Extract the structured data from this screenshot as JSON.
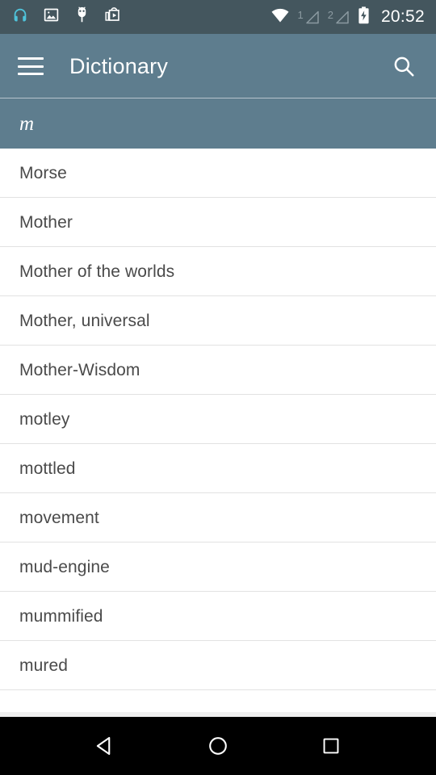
{
  "status_bar": {
    "background": "#44565E",
    "time": "20:52",
    "left_icons": [
      {
        "name": "headphones-icon",
        "label": "headphones"
      },
      {
        "name": "image-icon",
        "label": "image"
      },
      {
        "name": "android-debug-icon",
        "label": "android debug"
      },
      {
        "name": "play-store-icon",
        "label": "play store"
      }
    ],
    "right_icons": [
      {
        "name": "wifi-icon",
        "label": "wifi"
      },
      {
        "name": "signal-1-icon",
        "label": "signal 1",
        "number": "1"
      },
      {
        "name": "signal-2-icon",
        "label": "signal 2",
        "number": "2"
      },
      {
        "name": "battery-charging-icon",
        "label": "battery charging"
      }
    ]
  },
  "app_bar": {
    "background": "#5E7D8E",
    "menu_icon": "hamburger-menu-icon",
    "title": "Dictionary",
    "search_icon": "search-icon"
  },
  "section": {
    "background": "#5E7D8E",
    "letter": "m"
  },
  "list": {
    "text_color": "#4a4a4a",
    "divider_color": "#e2e2e2",
    "items": [
      {
        "label": "Morse"
      },
      {
        "label": "Mother"
      },
      {
        "label": "Mother of the worlds"
      },
      {
        "label": "Mother, universal"
      },
      {
        "label": "Mother-Wisdom"
      },
      {
        "label": "motley"
      },
      {
        "label": "mottled"
      },
      {
        "label": "movement"
      },
      {
        "label": "mud-engine"
      },
      {
        "label": "mummified"
      },
      {
        "label": "mured"
      }
    ]
  },
  "nav_bar": {
    "background": "#000000",
    "buttons": [
      {
        "name": "nav-back-button",
        "label": "Back"
      },
      {
        "name": "nav-home-button",
        "label": "Home"
      },
      {
        "name": "nav-recents-button",
        "label": "Recents"
      }
    ]
  }
}
